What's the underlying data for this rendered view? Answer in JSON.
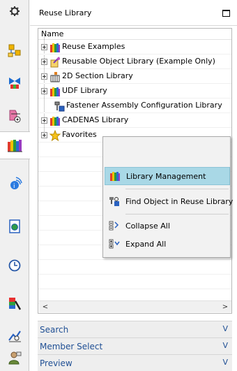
{
  "panel": {
    "title": "Reuse Library",
    "column_header": "Name"
  },
  "tree": {
    "items": [
      {
        "label": "Reuse Examples",
        "expandable": true
      },
      {
        "label": "Reusable Object Library (Example Only)",
        "expandable": true
      },
      {
        "label": "2D Section Library",
        "expandable": true
      },
      {
        "label": "UDF Library",
        "expandable": true
      },
      {
        "label": "Fastener Assembly Configuration Library",
        "expandable": false
      },
      {
        "label": "CADENAS Library",
        "expandable": true
      },
      {
        "label": "Favorites",
        "expandable": true
      }
    ]
  },
  "context_menu": {
    "items": [
      {
        "label": "Library Management",
        "icon": "library-books-icon",
        "highlighted": true
      },
      {
        "label": "Find Object in Reuse Library",
        "icon": "find-object-icon",
        "highlighted": false
      },
      {
        "label": "Collapse All",
        "icon": "collapse-all-icon",
        "highlighted": false
      },
      {
        "label": "Expand All",
        "icon": "expand-all-icon",
        "highlighted": false
      }
    ]
  },
  "scroll": {
    "left": "<",
    "right": ">"
  },
  "bottom_panes": [
    {
      "label": "Search",
      "arrow": "V"
    },
    {
      "label": "Member Select",
      "arrow": "V"
    },
    {
      "label": "Preview",
      "arrow": "V"
    }
  ],
  "resource_bar": {
    "icons": [
      "gear-icon",
      "assembly-navigator-icon",
      "constraint-navigator-icon",
      "part-navigator-icon",
      "reuse-library-icon",
      "hd3d-tools-icon",
      "web-browser-icon",
      "history-icon",
      "system-materials-icon",
      "process-studio-icon",
      "roles-icon"
    ]
  },
  "colors": {
    "menu_highlight": "#a9d8e6",
    "pane_label": "#1f4f94"
  }
}
